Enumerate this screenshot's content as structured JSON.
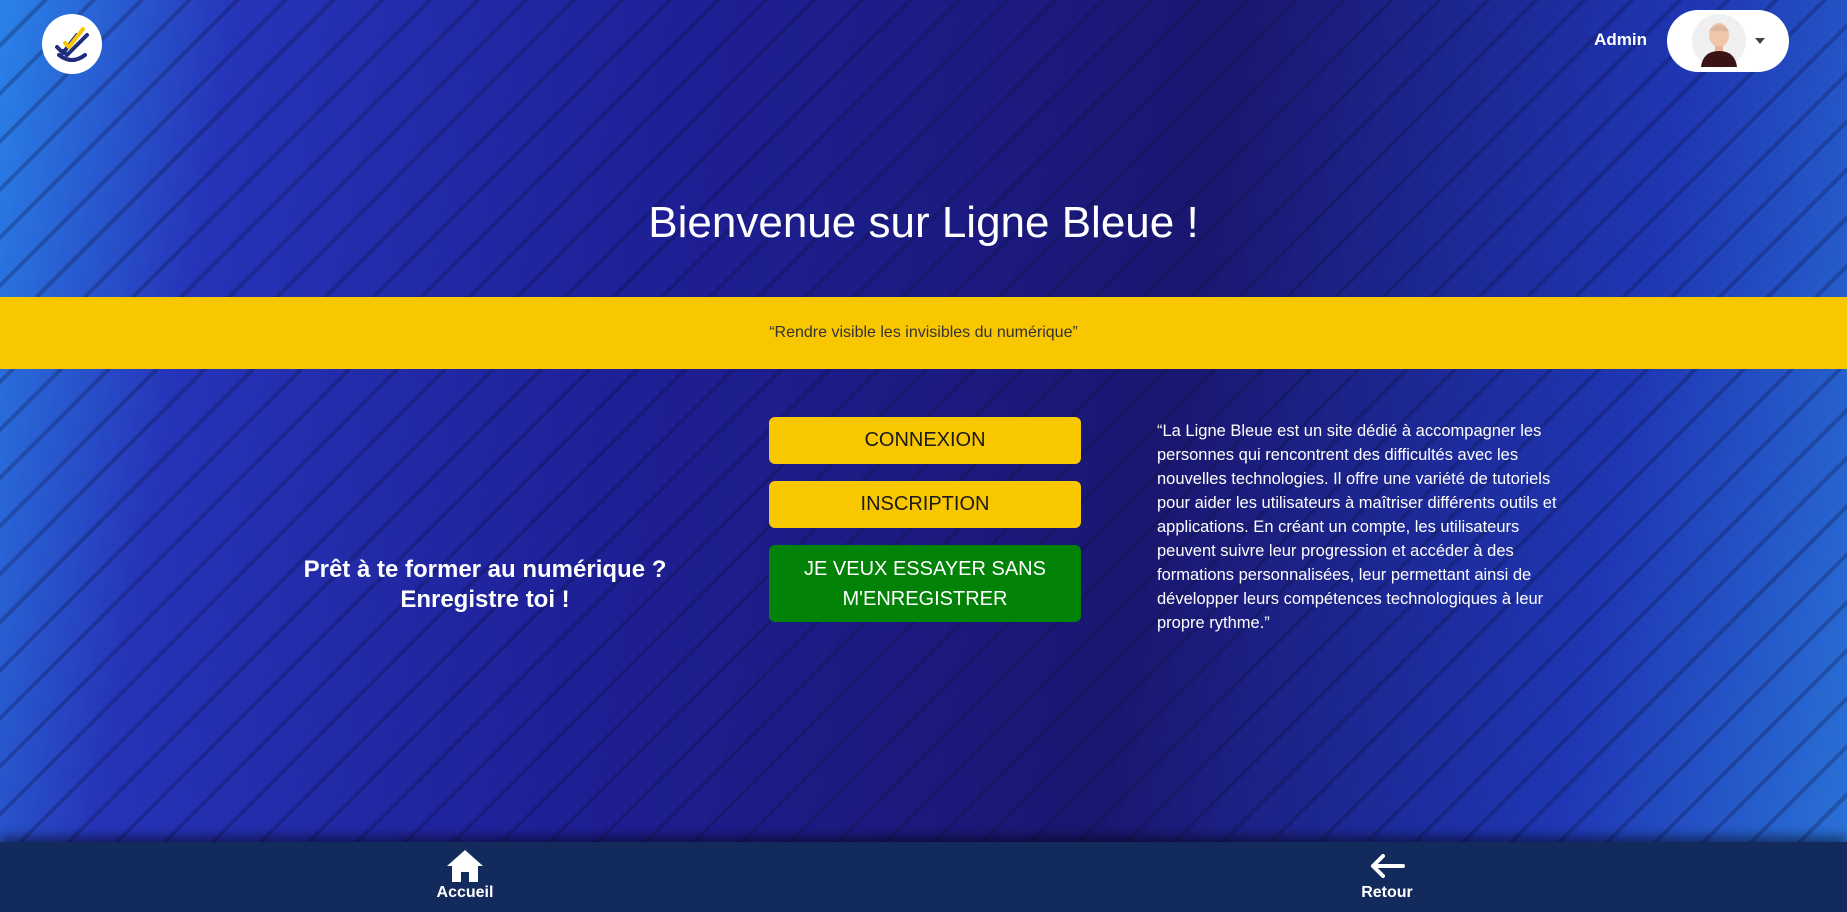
{
  "header": {
    "user_label": "Admin"
  },
  "hero": {
    "title": "Bienvenue sur Ligne Bleue !",
    "slogan": "“Rendre visible les invisibles du numérique”"
  },
  "cta": {
    "line1": "Prêt à te former au numérique ?",
    "line2": "Enregistre toi !"
  },
  "buttons": {
    "login": "CONNEXION",
    "signup": "INSCRIPTION",
    "try": "JE VEUX ESSAYER SANS M'ENREGISTRER"
  },
  "description": "“La Ligne Bleue est un site dédié à accompagner les personnes qui rencontrent des difficultés avec les nouvelles technologies. Il offre une variété de tutoriels pour aider les utilisateurs à maîtriser différents outils et applications. En créant un compte, les utilisateurs peuvent suivre leur progression et accéder à des formations personnalisées, leur permettant ainsi de développer leurs compétences technologiques à leur propre rythme.”",
  "footer": {
    "home_label": "Accueil",
    "back_label": "Retour"
  },
  "icons": {
    "logo": "checkmark-logo-icon",
    "avatar": "user-avatar-icon",
    "dropdown": "caret-down-icon",
    "home": "home-icon",
    "back": "arrow-left-icon"
  },
  "colors": {
    "accent_yellow": "#f9c700",
    "try_green": "#028206",
    "footer_bg": "#132a5c",
    "logo_blue": "#1f2d7a"
  }
}
